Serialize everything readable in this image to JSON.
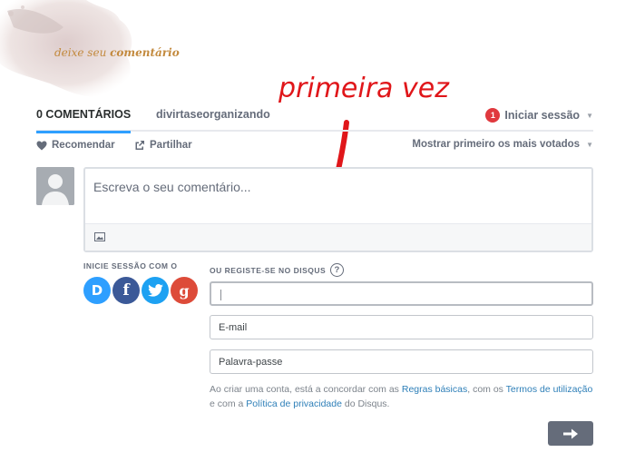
{
  "header": {
    "prefix": "deixe seu",
    "emphasis": "comentário"
  },
  "annotation": {
    "text": "primeira vez",
    "color": "#e0161a"
  },
  "nav": {
    "comment_count_tab": "0 COMENTÁRIOS",
    "forum_tab": "divirtaseorganizando",
    "notification_count": "1",
    "login": "Iniciar sessão"
  },
  "actions": {
    "recommend": "Recomendar",
    "share": "Partilhar",
    "sort": "Mostrar primeiro os mais votados"
  },
  "composer": {
    "placeholder": "Escreva o seu comentário..."
  },
  "social": {
    "label": "INICIE SESSÃO COM O",
    "providers": [
      "disqus",
      "facebook",
      "twitter",
      "google"
    ]
  },
  "register": {
    "label": "OU REGISTE-SE NO DISQUS",
    "help": "?",
    "name_value": "",
    "email_placeholder": "E-mail",
    "password_placeholder": "Palavra-passe"
  },
  "terms": {
    "part1": "Ao criar uma conta, está a concordar com as ",
    "link1": "Regras básicas",
    "part2": ", com os ",
    "link2": "Termos de utilização",
    "part3": " e com a ",
    "link3": "Política de privacidade",
    "part4": " do Disqus."
  },
  "colors": {
    "accent": "#2e9fff",
    "link": "#2e7fb8",
    "muted": "#656c7a",
    "notification": "#e0393e",
    "header_text": "#c38a3e"
  }
}
